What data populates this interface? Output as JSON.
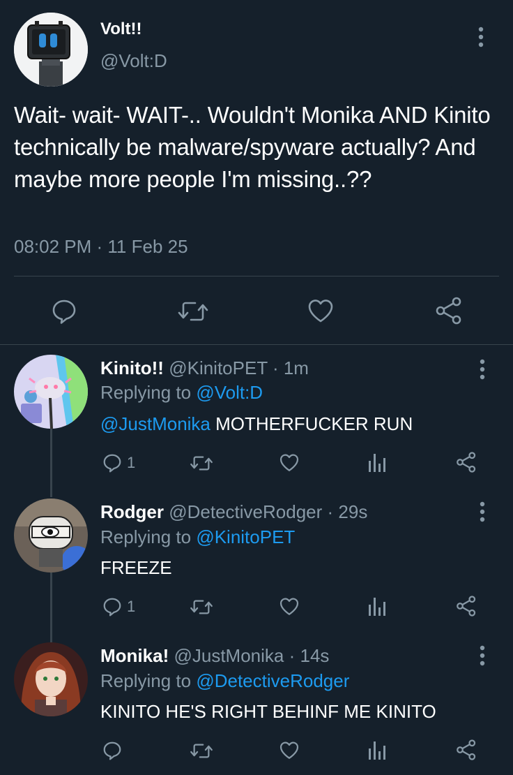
{
  "colors": {
    "background": "#15202b",
    "text": "#ffffff",
    "secondary": "#8899a6",
    "accent": "#1d9bf0",
    "divider": "#38444d"
  },
  "main_tweet": {
    "name": "Volt!!",
    "handle": "@Volt:D",
    "text": "Wait- wait- WAIT-.. Wouldn't Monika AND Kinito technically be malware/spyware actually? And maybe more people I'm missing..??",
    "timestamp": "08:02 PM · 11 Feb 25",
    "actions": [
      "reply-icon",
      "retweet-icon",
      "like-icon",
      "share-icon"
    ]
  },
  "replies": [
    {
      "name": "Kinito!!",
      "handle": "@KinitoPET",
      "time": "· 1m",
      "replying_prefix": "Replying to",
      "replying_to": "@Volt:D",
      "mention": "@JustMonika",
      "text": " MOTHERFUCKER RUN",
      "reply_count": "1"
    },
    {
      "name": "Rodger",
      "handle": "@DetectiveRodger",
      "time": "· 29s",
      "replying_prefix": "Replying to",
      "replying_to": "@KinitoPET",
      "mention": "",
      "text": "FREEZE",
      "reply_count": "1"
    },
    {
      "name": "Monika!",
      "handle": "@JustMonika",
      "time": "· 14s",
      "replying_prefix": "Replying to",
      "replying_to": "@DetectiveRodger",
      "mention": "",
      "text": "KINITO HE'S RIGHT BEHINF ME KINITO",
      "reply_count": ""
    }
  ]
}
